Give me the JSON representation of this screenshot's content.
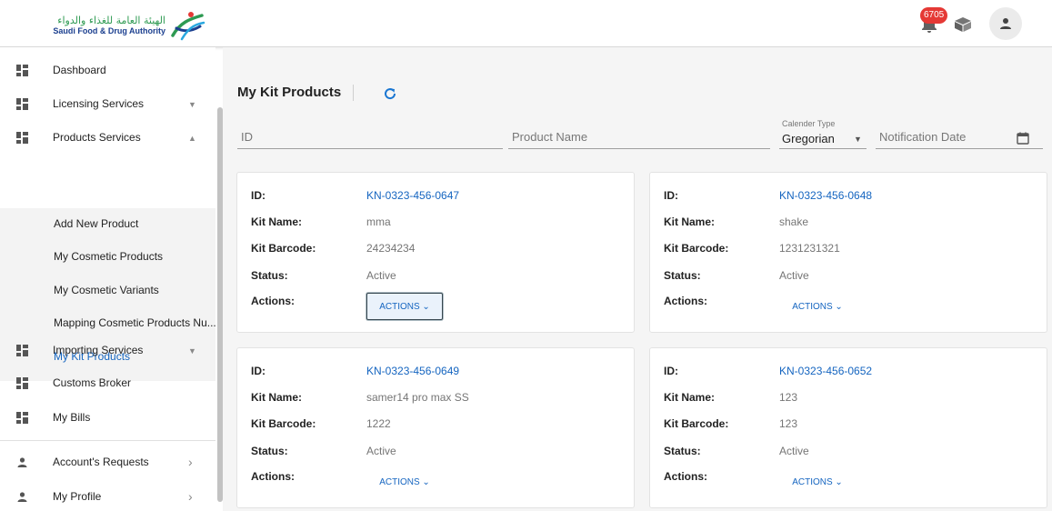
{
  "header": {
    "logo_ar": "الهيئة العامة للغذاء والدواء",
    "logo_en": "Saudi Food & Drug Authority",
    "notification_count": "6705"
  },
  "sidebar": {
    "items": [
      {
        "label": "Dashboard",
        "icon": "grid-icon"
      },
      {
        "label": "Licensing Services",
        "icon": "grid-icon",
        "chevron": "▼"
      },
      {
        "label": "Products Services",
        "icon": "grid-icon",
        "chevron": "▲"
      },
      {
        "label": "Importing Services",
        "icon": "grid-icon",
        "chevron": "▼"
      },
      {
        "label": "Customs Broker",
        "icon": "grid-icon"
      },
      {
        "label": "My Bills",
        "icon": "grid-icon"
      },
      {
        "label": "Account's Requests",
        "icon": "person-icon",
        "chevron": "›"
      },
      {
        "label": "My Profile",
        "icon": "person-icon",
        "chevron": "›"
      }
    ],
    "subitems": [
      {
        "label": "Add New Product"
      },
      {
        "label": "My Cosmetic Products"
      },
      {
        "label": "My Cosmetic Variants"
      },
      {
        "label": "Mapping Cosmetic Products Nu..."
      },
      {
        "label": "My Kit Products",
        "active": true
      }
    ]
  },
  "main": {
    "title": "My Kit Products",
    "filters": {
      "id_placeholder": "ID",
      "product_name_placeholder": "Product Name",
      "calendar_label": "Calender Type",
      "calendar_value": "Gregorian",
      "notification_date_placeholder": "Notification Date"
    },
    "labels": {
      "id": "ID:",
      "kit_name": "Kit Name:",
      "kit_barcode": "Kit Barcode:",
      "status": "Status:",
      "actions": "Actions:"
    },
    "actions_label": "ACTIONS ⌄",
    "cards": [
      {
        "id": "KN-0323-456-0647",
        "kit_name": "mma",
        "kit_barcode": "24234234",
        "status": "Active"
      },
      {
        "id": "KN-0323-456-0648",
        "kit_name": "shake",
        "kit_barcode": "1231231321",
        "status": "Active"
      },
      {
        "id": "KN-0323-456-0649",
        "kit_name": "samer14 pro max SS",
        "kit_barcode": "1222",
        "status": "Active"
      },
      {
        "id": "KN-0323-456-0652",
        "kit_name": "123",
        "kit_barcode": "123",
        "status": "Active"
      }
    ]
  },
  "colors": {
    "accent": "#1565c0",
    "badge": "#e53935",
    "brand_green": "#2e9a52",
    "brand_blue": "#1b3f8f"
  }
}
